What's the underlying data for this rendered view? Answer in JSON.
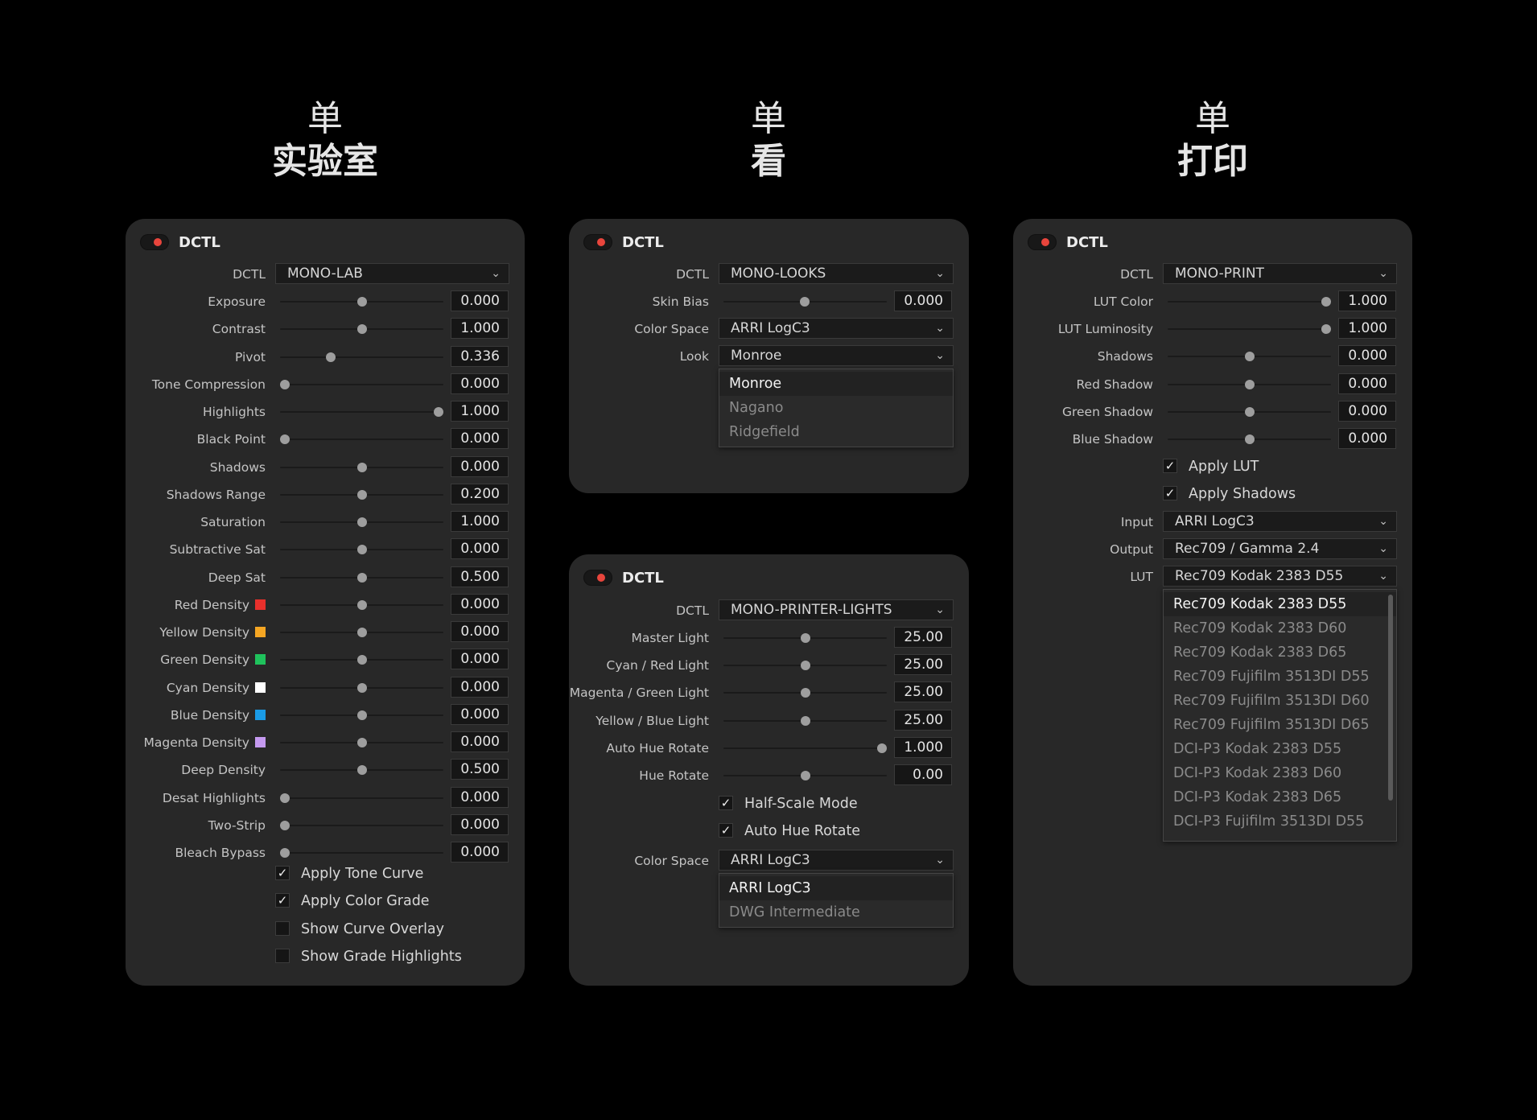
{
  "titles": [
    {
      "line1": "单",
      "line2": "实验室"
    },
    {
      "line1": "单",
      "line2": "看"
    },
    {
      "line1": "单",
      "line2": "打印"
    }
  ],
  "colors": {
    "toggle_dot": "#e8453c",
    "panel": "#282828",
    "background": "#000000"
  },
  "lab": {
    "header": "DCTL",
    "dctl_label": "DCTL",
    "dctl_value": "MONO-LAB",
    "sliders": [
      {
        "label": "Exposure",
        "value": "0.000",
        "pos": 0.5
      },
      {
        "label": "Contrast",
        "value": "1.000",
        "pos": 0.5
      },
      {
        "label": "Pivot",
        "value": "0.336",
        "pos": 0.3
      },
      {
        "label": "Tone Compression",
        "value": "0.000",
        "pos": 0.0
      },
      {
        "label": "Highlights",
        "value": "1.000",
        "pos": 1.0
      },
      {
        "label": "Black Point",
        "value": "0.000",
        "pos": 0.0
      },
      {
        "label": "Shadows",
        "value": "0.000",
        "pos": 0.5
      },
      {
        "label": "Shadows Range",
        "value": "0.200",
        "pos": 0.5
      },
      {
        "label": "Saturation",
        "value": "1.000",
        "pos": 0.5
      },
      {
        "label": "Subtractive Sat",
        "value": "0.000",
        "pos": 0.5
      },
      {
        "label": "Deep Sat",
        "value": "0.500",
        "pos": 0.5
      },
      {
        "label": "Red Density",
        "value": "0.000",
        "pos": 0.5,
        "swatch": "#e8302c"
      },
      {
        "label": "Yellow Density",
        "value": "0.000",
        "pos": 0.5,
        "swatch": "#f5a623"
      },
      {
        "label": "Green Density",
        "value": "0.000",
        "pos": 0.5,
        "swatch": "#1fc25c"
      },
      {
        "label": "Cyan Density",
        "value": "0.000",
        "pos": 0.5,
        "swatch": "#ffffff"
      },
      {
        "label": "Blue Density",
        "value": "0.000",
        "pos": 0.5,
        "swatch": "#1a9be6"
      },
      {
        "label": "Magenta Density",
        "value": "0.000",
        "pos": 0.5,
        "swatch": "#c59af0"
      },
      {
        "label": "Deep Density",
        "value": "0.500",
        "pos": 0.5
      },
      {
        "label": "Desat Highlights",
        "value": "0.000",
        "pos": 0.0
      },
      {
        "label": "Two-Strip",
        "value": "0.000",
        "pos": 0.0
      },
      {
        "label": "Bleach Bypass",
        "value": "0.000",
        "pos": 0.0
      }
    ],
    "checkboxes": [
      {
        "label": "Apply Tone Curve",
        "checked": true
      },
      {
        "label": "Apply Color Grade",
        "checked": true
      },
      {
        "label": "Show Curve Overlay",
        "checked": false
      },
      {
        "label": "Show Grade Highlights",
        "checked": false
      }
    ]
  },
  "looks": {
    "header": "DCTL",
    "dctl_label": "DCTL",
    "dctl_value": "MONO-LOOKS",
    "skin_bias": {
      "label": "Skin Bias",
      "value": "0.000",
      "pos": 0.5
    },
    "color_space": {
      "label": "Color Space",
      "value": "ARRI LogC3"
    },
    "look": {
      "label": "Look",
      "value": "Monroe"
    },
    "look_options": [
      "Monroe",
      "Nagano",
      "Ridgefield"
    ]
  },
  "printer": {
    "header": "DCTL",
    "dctl_label": "DCTL",
    "dctl_value": "MONO-PRINTER-LIGHTS",
    "sliders": [
      {
        "label": "Master Light",
        "value": "25.00",
        "pos": 0.5
      },
      {
        "label": "Cyan / Red Light",
        "value": "25.00",
        "pos": 0.5
      },
      {
        "label": "Magenta / Green Light",
        "value": "25.00",
        "pos": 0.5
      },
      {
        "label": "Yellow / Blue Light",
        "value": "25.00",
        "pos": 0.5
      },
      {
        "label": "Auto Hue Rotate",
        "value": "1.000",
        "pos": 1.0
      },
      {
        "label": "Hue Rotate",
        "value": "0.00",
        "pos": 0.5
      }
    ],
    "checkboxes": [
      {
        "label": "Half-Scale Mode",
        "checked": true
      },
      {
        "label": "Auto Hue Rotate",
        "checked": true
      }
    ],
    "color_space": {
      "label": "Color Space",
      "value": "ARRI LogC3"
    },
    "color_space_options": [
      "ARRI LogC3",
      "DWG Intermediate"
    ]
  },
  "print": {
    "header": "DCTL",
    "dctl_label": "DCTL",
    "dctl_value": "MONO-PRINT",
    "sliders": [
      {
        "label": "LUT Color",
        "value": "1.000",
        "pos": 1.0
      },
      {
        "label": "LUT Luminosity",
        "value": "1.000",
        "pos": 1.0
      },
      {
        "label": "Shadows",
        "value": "0.000",
        "pos": 0.5
      },
      {
        "label": "Red Shadow",
        "value": "0.000",
        "pos": 0.5
      },
      {
        "label": "Green Shadow",
        "value": "0.000",
        "pos": 0.5
      },
      {
        "label": "Blue Shadow",
        "value": "0.000",
        "pos": 0.5
      }
    ],
    "checkboxes": [
      {
        "label": "Apply LUT",
        "checked": true
      },
      {
        "label": "Apply Shadows",
        "checked": true
      }
    ],
    "input": {
      "label": "Input",
      "value": "ARRI LogC3"
    },
    "output": {
      "label": "Output",
      "value": "Rec709 / Gamma 2.4"
    },
    "lut": {
      "label": "LUT",
      "value": "Rec709 Kodak 2383 D55"
    },
    "lut_options": [
      "Rec709 Kodak 2383 D55",
      "Rec709 Kodak 2383 D60",
      "Rec709 Kodak 2383 D65",
      "Rec709 Fujifilm 3513DI D55",
      "Rec709 Fujifilm 3513DI D60",
      "Rec709 Fujifilm 3513DI D65",
      "DCI-P3 Kodak 2383 D55",
      "DCI-P3 Kodak 2383 D60",
      "DCI-P3 Kodak 2383 D65",
      "DCI-P3 Fujifilm 3513DI D55"
    ]
  }
}
